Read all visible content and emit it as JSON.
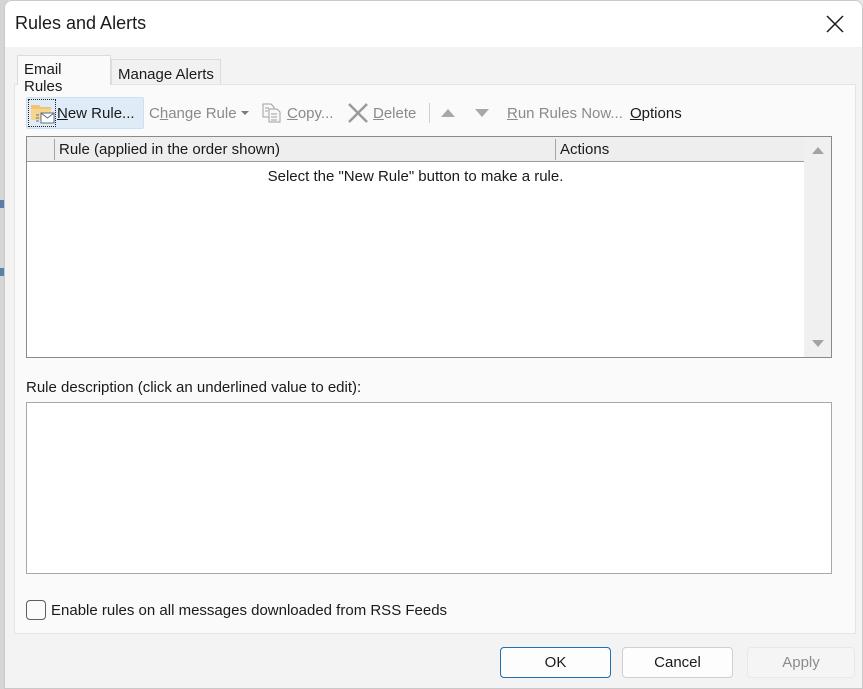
{
  "window": {
    "title": "Rules and Alerts",
    "close_icon": "close-icon"
  },
  "tabs": [
    {
      "label": "Email Rules",
      "active": true
    },
    {
      "label": "Manage Alerts",
      "active": false
    }
  ],
  "toolbar": {
    "new_rule": {
      "label": "New Rule...",
      "mnemonic": "N",
      "rest": "ew Rule...",
      "icon": "new-rule-folder-icon",
      "enabled": true
    },
    "change_rule": {
      "pre": "C",
      "mnemonic": "h",
      "rest": "ange Rule",
      "icon": "dropdown-caret-icon",
      "enabled": false
    },
    "copy": {
      "mnemonic": "C",
      "rest": "opy...",
      "icon": "copy-icon",
      "enabled": false
    },
    "delete": {
      "mnemonic": "D",
      "rest": "elete",
      "icon": "delete-x-icon",
      "enabled": false
    },
    "move_up": {
      "icon": "arrow-up-icon",
      "enabled": false
    },
    "move_down": {
      "icon": "arrow-down-icon",
      "enabled": false
    },
    "run_rules_now": {
      "mnemonic": "R",
      "rest": "un Rules Now...",
      "enabled": false
    },
    "options": {
      "mnemonic": "O",
      "rest": "ptions",
      "enabled": true
    }
  },
  "rules_list": {
    "columns": [
      "Rule (applied in the order shown)",
      "Actions"
    ],
    "rows": [],
    "empty_message": "Select the \"New Rule\" button to make a rule."
  },
  "description": {
    "label": "Rule description (click an underlined value to edit):",
    "content": ""
  },
  "rss_option": {
    "label": "Enable rules on all messages downloaded from RSS Feeds",
    "checked": false
  },
  "footer": {
    "ok": "OK",
    "cancel": "Cancel",
    "apply": "Apply"
  },
  "colors": {
    "accent": "#1f6fb1",
    "selected_button_bg": "#dfecf8",
    "disabled_text": "#8a8a8a"
  }
}
